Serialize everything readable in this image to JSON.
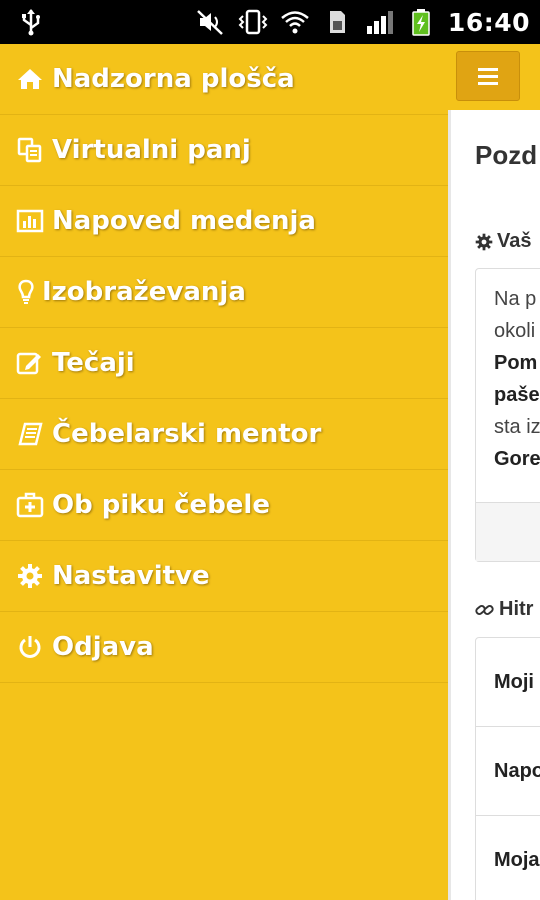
{
  "status_bar": {
    "time": "16:40",
    "icons": [
      "usb-icon",
      "mute-icon",
      "vibrate-icon",
      "wifi-icon",
      "sim-icon",
      "signal-icon",
      "battery-charging-icon"
    ]
  },
  "menu": {
    "items": [
      {
        "label": "Nadzorna plošča",
        "icon": "home-icon"
      },
      {
        "label": "Virtualni panj",
        "icon": "copy-icon"
      },
      {
        "label": "Napoved medenja",
        "icon": "bar-chart-icon"
      },
      {
        "label": "Izobraževanja",
        "icon": "lightbulb-icon"
      },
      {
        "label": "Tečaji",
        "icon": "edit-icon"
      },
      {
        "label": "Čebelarski mentor",
        "icon": "book-icon"
      },
      {
        "label": "Ob piku čebele",
        "icon": "medkit-icon"
      },
      {
        "label": "Nastavitve",
        "icon": "gear-icon"
      },
      {
        "label": "Odjava",
        "icon": "power-icon"
      }
    ]
  },
  "content": {
    "title": "Pozd",
    "section1": "Vaš",
    "panel_lines": [
      "Na p",
      "okoli",
      "Pom",
      "paše",
      "sta iz",
      "Gore"
    ],
    "section2": "Hitr",
    "quick_links": [
      "Moji",
      "Napo",
      "Moja"
    ]
  },
  "colors": {
    "menu_bg": "#f4c31a",
    "menu_text": "#ffffff",
    "button": "#e0a413"
  }
}
